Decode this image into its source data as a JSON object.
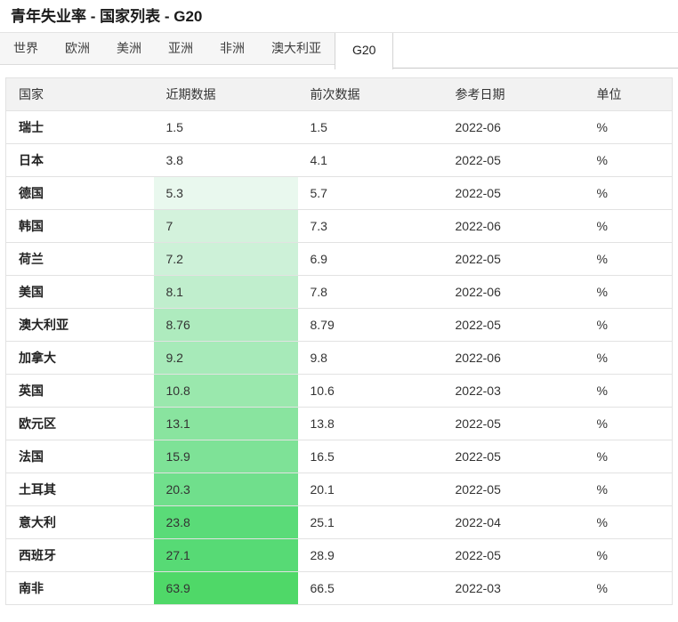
{
  "header": {
    "title": "青年失业率 - 国家列表 - G20"
  },
  "tabs": {
    "items": [
      "世界",
      "欧洲",
      "美洲",
      "亚洲",
      "非洲",
      "澳大利亚",
      "G20"
    ],
    "active": "G20"
  },
  "colors": {
    "heat_scale_low": "#e9f8ee",
    "heat_scale_high": "#4fd868",
    "header_bg": "#f2f2f2",
    "row_border": "#e2e2e2"
  },
  "table": {
    "columns": [
      "国家",
      "近期数据",
      "前次数据",
      "参考日期",
      "单位"
    ],
    "rows": [
      {
        "country": "瑞士",
        "latest": "1.5",
        "previous": "1.5",
        "date": "2022-06",
        "unit": "%",
        "heat_color": ""
      },
      {
        "country": "日本",
        "latest": "3.8",
        "previous": "4.1",
        "date": "2022-05",
        "unit": "%",
        "heat_color": ""
      },
      {
        "country": "德国",
        "latest": "5.3",
        "previous": "5.7",
        "date": "2022-05",
        "unit": "%",
        "heat_color": "#e9f8ee"
      },
      {
        "country": "韩国",
        "latest": "7",
        "previous": "7.3",
        "date": "2022-06",
        "unit": "%",
        "heat_color": "#d3f2dc"
      },
      {
        "country": "荷兰",
        "latest": "7.2",
        "previous": "6.9",
        "date": "2022-05",
        "unit": "%",
        "heat_color": "#cdf1d8"
      },
      {
        "country": "美国",
        "latest": "8.1",
        "previous": "7.8",
        "date": "2022-06",
        "unit": "%",
        "heat_color": "#c0eecd"
      },
      {
        "country": "澳大利亚",
        "latest": "8.76",
        "previous": "8.79",
        "date": "2022-05",
        "unit": "%",
        "heat_color": "#aeebbe"
      },
      {
        "country": "加拿大",
        "latest": "9.2",
        "previous": "9.8",
        "date": "2022-06",
        "unit": "%",
        "heat_color": "#a7eab9"
      },
      {
        "country": "英国",
        "latest": "10.8",
        "previous": "10.6",
        "date": "2022-03",
        "unit": "%",
        "heat_color": "#9ae8ad"
      },
      {
        "country": "欧元区",
        "latest": "13.1",
        "previous": "13.8",
        "date": "2022-05",
        "unit": "%",
        "heat_color": "#89e49f"
      },
      {
        "country": "法国",
        "latest": "15.9",
        "previous": "16.5",
        "date": "2022-05",
        "unit": "%",
        "heat_color": "#7ee297"
      },
      {
        "country": "土耳其",
        "latest": "20.3",
        "previous": "20.1",
        "date": "2022-05",
        "unit": "%",
        "heat_color": "#70df8c"
      },
      {
        "country": "意大利",
        "latest": "23.8",
        "previous": "25.1",
        "date": "2022-04",
        "unit": "%",
        "heat_color": "#5adb78"
      },
      {
        "country": "西班牙",
        "latest": "27.1",
        "previous": "28.9",
        "date": "2022-05",
        "unit": "%",
        "heat_color": "#57da75"
      },
      {
        "country": "南非",
        "latest": "63.9",
        "previous": "66.5",
        "date": "2022-03",
        "unit": "%",
        "heat_color": "#4fd868"
      }
    ]
  }
}
